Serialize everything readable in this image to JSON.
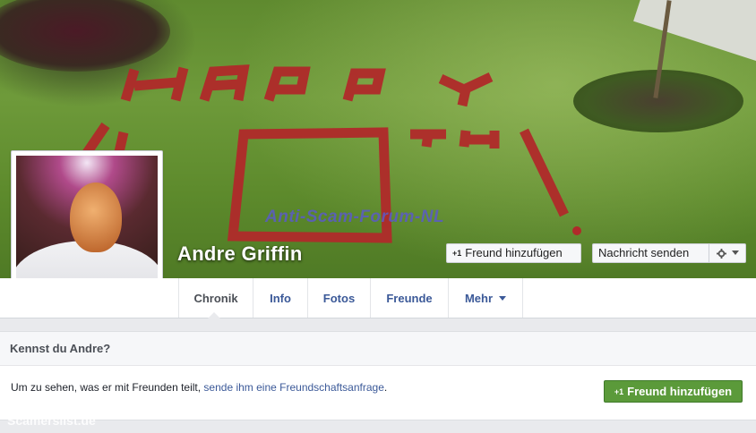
{
  "cover": {
    "photo_lettering": [
      "HAPPY",
      "40",
      "TH",
      "!"
    ],
    "watermark": "Anti-Scam-Forum-NL"
  },
  "profile": {
    "name": "Andre Griffin"
  },
  "actions": {
    "add_friend_icon": "+1",
    "add_friend": "Freund hinzufügen",
    "send_message": "Nachricht senden",
    "settings_icon": "gear-icon"
  },
  "tabs": [
    {
      "label": "Chronik",
      "active": true
    },
    {
      "label": "Info"
    },
    {
      "label": "Fotos"
    },
    {
      "label": "Freunde"
    },
    {
      "label": "Mehr"
    }
  ],
  "card": {
    "title": "Kennst du Andre?",
    "text": "Um zu sehen, was er mit Freunden teilt, ",
    "link": "sende ihm eine Freundschaftsanfrage",
    "text_end": ".",
    "button_icon": "+1",
    "button": "Freund hinzufügen"
  },
  "footer_watermark": "Scamerslist.de",
  "colors": {
    "link": "#3b5998",
    "green_button": "#5b9a3a",
    "lettering_red": "#b02a2a"
  }
}
